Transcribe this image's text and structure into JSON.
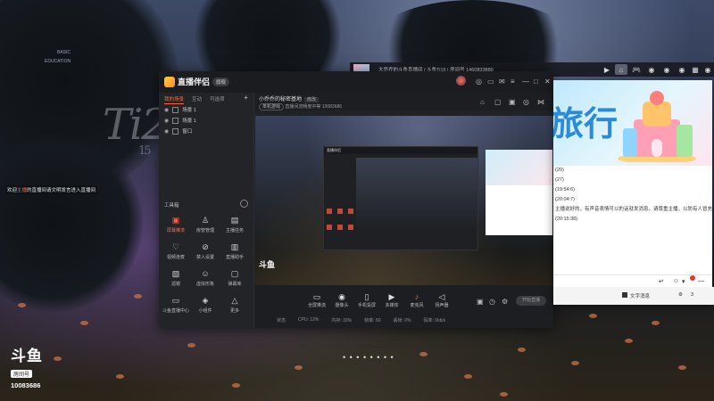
{
  "desktop": {
    "watermark": "Ti20",
    "watermark_sub": "15",
    "tiny_label_1": "BASIC",
    "tiny_label_2": "EDUCATION",
    "welcome_prefix": "欢迎",
    "welcome_user": "主播",
    "welcome_suffix": "的直播间请文明发言进入直播间",
    "brand": "斗鱼",
    "room_label": "房间号",
    "room_number": "10083686",
    "dots": "• • • • • • • •"
  },
  "taskbar": {
    "title": "大乔乔的斗鱼直播间 / 斗鱼Ti15 | 房间号 1460833880",
    "buttons": [
      "play-icon",
      "home-icon",
      "gamepad-icon",
      "gamepad-icon",
      "gamepad-icon",
      "gamepad-icon",
      "grid-icon",
      "gamepad-icon"
    ]
  },
  "app": {
    "name": "直播伴侣",
    "version": "旗舰",
    "window_controls": [
      "menu-icon",
      "minimize-icon",
      "maximize-icon",
      "close-icon"
    ],
    "toolbar_icons": [
      "skin-icon",
      "message-icon",
      "mail-icon",
      "settings-icon"
    ],
    "left_tabs": [
      "我的场景",
      "互动",
      "可选项"
    ],
    "scenes": [
      "场景 1",
      "场景 1",
      "窗口"
    ],
    "tools_label": "工具箱",
    "tools": [
      {
        "label": "屏幕推流",
        "icon": "screen-cast-icon",
        "highlight": true
      },
      {
        "label": "房管管理",
        "icon": "user-admin-icon",
        "highlight": false
      },
      {
        "label": "主播任务",
        "icon": "task-icon",
        "highlight": false
      },
      {
        "label": "视频连麦",
        "icon": "video-call-icon",
        "highlight": false
      },
      {
        "label": "禁入设置",
        "icon": "block-icon",
        "highlight": false
      },
      {
        "label": "直播助手",
        "icon": "assistant-icon",
        "highlight": false
      },
      {
        "label": "滤镜",
        "icon": "filter-icon",
        "highlight": false
      },
      {
        "label": "虚拟形象",
        "icon": "avatar-icon",
        "highlight": false
      },
      {
        "label": "弹幕库",
        "icon": "danmaku-icon",
        "highlight": false
      },
      {
        "label": "斗鱼直播中心",
        "icon": "center-icon",
        "highlight": false
      },
      {
        "label": "小组件",
        "icon": "widget-icon",
        "highlight": false
      },
      {
        "label": "更多",
        "icon": "more-icon",
        "highlight": false
      }
    ],
    "stream": {
      "title": "小乔乔的秘密基地",
      "edit": "修改",
      "category": "单机游戏",
      "sub": "直播间流畅度中等 10083686"
    },
    "preview_badge": "斗鱼",
    "nested_title": "直播伴侣",
    "bottom_buttons": [
      {
        "label": "全屏推流",
        "icon": "screen-icon"
      },
      {
        "label": "摄像头",
        "icon": "camera-icon"
      },
      {
        "label": "手机投屏",
        "icon": "phone-icon"
      },
      {
        "label": "多媒体",
        "icon": "media-icon"
      },
      {
        "label": "麦克风",
        "icon": "mic-icon"
      },
      {
        "label": "扬声器",
        "icon": "speaker-icon"
      }
    ],
    "start_label": "开始直播",
    "status_strip": [
      "状态",
      "CPU: 12%",
      "内存: 33%",
      "帧率: 60",
      "丢帧: 0%",
      "码率: 0kb/s"
    ]
  },
  "chat": {
    "banner_text": "旅行",
    "lines": [
      "(20)",
      "(27)",
      "(19:54:6)",
      "(20:04:7)",
      "主播说好的，有声音表情可以的话就发消息。请尊重主播，以防有人冒充主播的",
      "(20:15:38)"
    ],
    "footer_label": "文字消息",
    "footer_count": "3"
  }
}
